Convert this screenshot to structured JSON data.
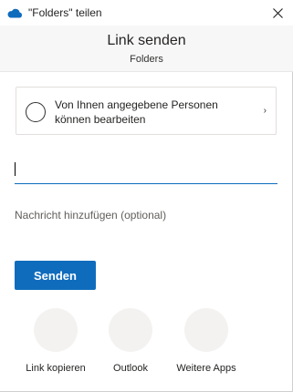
{
  "titlebar": {
    "title": "\"Folders\" teilen",
    "app_icon": "onedrive-cloud-icon",
    "close_icon": "close-icon"
  },
  "header": {
    "title": "Link senden",
    "subtitle": "Folders"
  },
  "permission": {
    "text": "Von Ihnen angegebene Personen können bearbeiten",
    "chevron": "›"
  },
  "to_field": {
    "value": "",
    "placeholder": ""
  },
  "message_field": {
    "value": "",
    "placeholder": "Nachricht hinzufügen (optional)"
  },
  "send_button": {
    "label": "Senden"
  },
  "share_apps": [
    {
      "label": "Link kopieren",
      "icon": "copy-link-icon"
    },
    {
      "label": "Outlook",
      "icon": "outlook-icon"
    },
    {
      "label": "Weitere Apps",
      "icon": "more-apps-icon"
    }
  ],
  "colors": {
    "accent": "#0f6cbd",
    "header_bg": "#f7f7f7",
    "circle_bg": "#f3f2f1"
  }
}
